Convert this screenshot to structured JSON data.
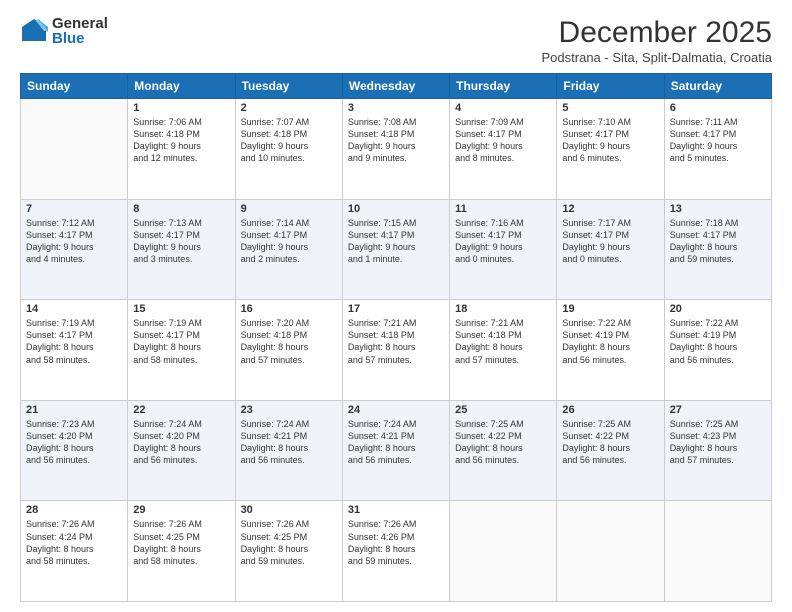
{
  "header": {
    "logo_general": "General",
    "logo_blue": "Blue",
    "month_title": "December 2025",
    "location": "Podstrana - Sita, Split-Dalmatia, Croatia"
  },
  "weekdays": [
    "Sunday",
    "Monday",
    "Tuesday",
    "Wednesday",
    "Thursday",
    "Friday",
    "Saturday"
  ],
  "weeks": [
    [
      {
        "day": "",
        "info": ""
      },
      {
        "day": "1",
        "info": "Sunrise: 7:06 AM\nSunset: 4:18 PM\nDaylight: 9 hours\nand 12 minutes."
      },
      {
        "day": "2",
        "info": "Sunrise: 7:07 AM\nSunset: 4:18 PM\nDaylight: 9 hours\nand 10 minutes."
      },
      {
        "day": "3",
        "info": "Sunrise: 7:08 AM\nSunset: 4:18 PM\nDaylight: 9 hours\nand 9 minutes."
      },
      {
        "day": "4",
        "info": "Sunrise: 7:09 AM\nSunset: 4:17 PM\nDaylight: 9 hours\nand 8 minutes."
      },
      {
        "day": "5",
        "info": "Sunrise: 7:10 AM\nSunset: 4:17 PM\nDaylight: 9 hours\nand 6 minutes."
      },
      {
        "day": "6",
        "info": "Sunrise: 7:11 AM\nSunset: 4:17 PM\nDaylight: 9 hours\nand 5 minutes."
      }
    ],
    [
      {
        "day": "7",
        "info": "Sunrise: 7:12 AM\nSunset: 4:17 PM\nDaylight: 9 hours\nand 4 minutes."
      },
      {
        "day": "8",
        "info": "Sunrise: 7:13 AM\nSunset: 4:17 PM\nDaylight: 9 hours\nand 3 minutes."
      },
      {
        "day": "9",
        "info": "Sunrise: 7:14 AM\nSunset: 4:17 PM\nDaylight: 9 hours\nand 2 minutes."
      },
      {
        "day": "10",
        "info": "Sunrise: 7:15 AM\nSunset: 4:17 PM\nDaylight: 9 hours\nand 1 minute."
      },
      {
        "day": "11",
        "info": "Sunrise: 7:16 AM\nSunset: 4:17 PM\nDaylight: 9 hours\nand 0 minutes."
      },
      {
        "day": "12",
        "info": "Sunrise: 7:17 AM\nSunset: 4:17 PM\nDaylight: 9 hours\nand 0 minutes."
      },
      {
        "day": "13",
        "info": "Sunrise: 7:18 AM\nSunset: 4:17 PM\nDaylight: 8 hours\nand 59 minutes."
      }
    ],
    [
      {
        "day": "14",
        "info": "Sunrise: 7:19 AM\nSunset: 4:17 PM\nDaylight: 8 hours\nand 58 minutes."
      },
      {
        "day": "15",
        "info": "Sunrise: 7:19 AM\nSunset: 4:17 PM\nDaylight: 8 hours\nand 58 minutes."
      },
      {
        "day": "16",
        "info": "Sunrise: 7:20 AM\nSunset: 4:18 PM\nDaylight: 8 hours\nand 57 minutes."
      },
      {
        "day": "17",
        "info": "Sunrise: 7:21 AM\nSunset: 4:18 PM\nDaylight: 8 hours\nand 57 minutes."
      },
      {
        "day": "18",
        "info": "Sunrise: 7:21 AM\nSunset: 4:18 PM\nDaylight: 8 hours\nand 57 minutes."
      },
      {
        "day": "19",
        "info": "Sunrise: 7:22 AM\nSunset: 4:19 PM\nDaylight: 8 hours\nand 56 minutes."
      },
      {
        "day": "20",
        "info": "Sunrise: 7:22 AM\nSunset: 4:19 PM\nDaylight: 8 hours\nand 56 minutes."
      }
    ],
    [
      {
        "day": "21",
        "info": "Sunrise: 7:23 AM\nSunset: 4:20 PM\nDaylight: 8 hours\nand 56 minutes."
      },
      {
        "day": "22",
        "info": "Sunrise: 7:24 AM\nSunset: 4:20 PM\nDaylight: 8 hours\nand 56 minutes."
      },
      {
        "day": "23",
        "info": "Sunrise: 7:24 AM\nSunset: 4:21 PM\nDaylight: 8 hours\nand 56 minutes."
      },
      {
        "day": "24",
        "info": "Sunrise: 7:24 AM\nSunset: 4:21 PM\nDaylight: 8 hours\nand 56 minutes."
      },
      {
        "day": "25",
        "info": "Sunrise: 7:25 AM\nSunset: 4:22 PM\nDaylight: 8 hours\nand 56 minutes."
      },
      {
        "day": "26",
        "info": "Sunrise: 7:25 AM\nSunset: 4:22 PM\nDaylight: 8 hours\nand 56 minutes."
      },
      {
        "day": "27",
        "info": "Sunrise: 7:25 AM\nSunset: 4:23 PM\nDaylight: 8 hours\nand 57 minutes."
      }
    ],
    [
      {
        "day": "28",
        "info": "Sunrise: 7:26 AM\nSunset: 4:24 PM\nDaylight: 8 hours\nand 58 minutes."
      },
      {
        "day": "29",
        "info": "Sunrise: 7:26 AM\nSunset: 4:25 PM\nDaylight: 8 hours\nand 58 minutes."
      },
      {
        "day": "30",
        "info": "Sunrise: 7:26 AM\nSunset: 4:25 PM\nDaylight: 8 hours\nand 59 minutes."
      },
      {
        "day": "31",
        "info": "Sunrise: 7:26 AM\nSunset: 4:26 PM\nDaylight: 8 hours\nand 59 minutes."
      },
      {
        "day": "",
        "info": ""
      },
      {
        "day": "",
        "info": ""
      },
      {
        "day": "",
        "info": ""
      }
    ]
  ]
}
